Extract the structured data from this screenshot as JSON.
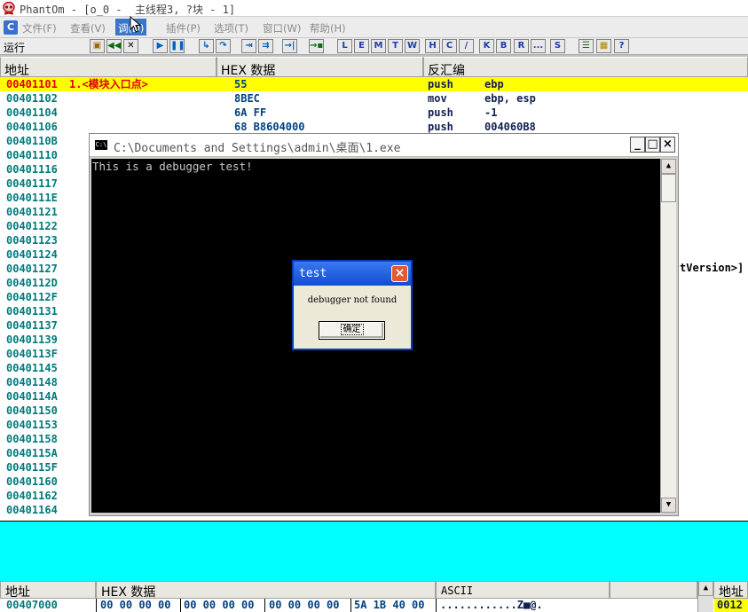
{
  "window": {
    "title": "PhantOm - [o_0 -  主线程3, ?块 - 1]"
  },
  "menu": {
    "logo": "C",
    "items": [
      {
        "label": "文件(F)"
      },
      {
        "label": "查看(V)"
      },
      {
        "label": "调(D)"
      },
      {
        "label": "插件(P)"
      },
      {
        "label": "选项(T)"
      },
      {
        "label": "窗口(W)"
      },
      {
        "label": "帮助(H)"
      }
    ]
  },
  "toolbar": {
    "status": "运行",
    "letters": [
      "L",
      "E",
      "M",
      "T",
      "W",
      "H",
      "C",
      "/",
      "K",
      "B",
      "R",
      "...",
      "S"
    ]
  },
  "cpu": {
    "headers": {
      "address": "地址",
      "hex": "HEX 数据",
      "disasm": "反汇编"
    },
    "rows": [
      {
        "addr": "00401101",
        "comment": "1.<模块入口点>",
        "hex": "55",
        "op": "push",
        "arg": "ebp",
        "selected": true
      },
      {
        "addr": "00401102",
        "hex": "8BEC",
        "op": "mov",
        "arg": "ebp, esp"
      },
      {
        "addr": "00401104",
        "hex": "6A FF",
        "op": "push",
        "arg": "-1"
      },
      {
        "addr": "00401106",
        "hex": "68 B8604000",
        "op": "push",
        "arg": "004060B8"
      },
      {
        "addr": "0040110B"
      },
      {
        "addr": "00401110"
      },
      {
        "addr": "00401116"
      },
      {
        "addr": "00401117"
      },
      {
        "addr": "0040111E"
      },
      {
        "addr": "00401121"
      },
      {
        "addr": "00401122"
      },
      {
        "addr": "00401123"
      },
      {
        "addr": "00401124"
      },
      {
        "addr": "00401127"
      },
      {
        "addr": "0040112D"
      },
      {
        "addr": "0040112F"
      },
      {
        "addr": "00401131"
      },
      {
        "addr": "00401137"
      },
      {
        "addr": "00401139"
      },
      {
        "addr": "0040113F"
      },
      {
        "addr": "00401145"
      },
      {
        "addr": "00401148"
      },
      {
        "addr": "0040114A"
      },
      {
        "addr": "00401150"
      },
      {
        "addr": "00401153"
      },
      {
        "addr": "00401158"
      },
      {
        "addr": "0040115A"
      },
      {
        "addr": "0040115F"
      },
      {
        "addr": "00401160"
      },
      {
        "addr": "00401162"
      },
      {
        "addr": "00401164"
      }
    ],
    "right_fragment": "tVersion>]"
  },
  "dump": {
    "headers": {
      "address": "地址",
      "hex": "HEX 数据",
      "ascii": "ASCII",
      "stack_address": "地址"
    },
    "row": {
      "addr": "00407000",
      "groups": [
        "00 00 00 00",
        "00 00 00 00",
        "00 00 00 00",
        "5A 1B 40 00"
      ],
      "ascii": "............Z■@.",
      "stack_addr": "0012"
    }
  },
  "console": {
    "title": "C:\\Documents and Settings\\admin\\桌面\\1.exe",
    "icon_text": "C:\\",
    "output": "This is a debugger test!",
    "controls": {
      "minimize": "_",
      "maximize": "□",
      "close": "×"
    }
  },
  "messagebox": {
    "title": "test",
    "message": "debugger not found",
    "ok_label": "确定",
    "close": "×"
  },
  "colors": {
    "selected_row": "#ffff00",
    "address_text": "#007a7a",
    "cyan_panel": "#00ffff",
    "dialog_title": "#1c5ee0"
  }
}
